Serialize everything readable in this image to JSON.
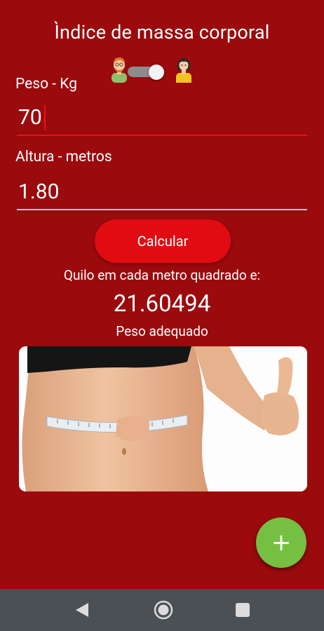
{
  "app": {
    "title": "Ìndice de massa corporal"
  },
  "gender_toggle": {
    "left_icon": "male-avatar-icon",
    "right_icon": "female-avatar-icon",
    "state": "on",
    "track_color": "#8c8c8c",
    "thumb_color": "#f2f2f2"
  },
  "form": {
    "peso_label": "Peso - Kg",
    "peso_value": "70",
    "altura_label": "Altura - metros",
    "altura_value": "1.80"
  },
  "actions": {
    "calcular_label": "Calcular",
    "fab_icon": "plus-icon",
    "fab_symbol": "+"
  },
  "result": {
    "caption": "Quilo em cada metro quadrado e:",
    "value": "21.60494",
    "status": "Peso adequado"
  },
  "image": {
    "subject": "waist-measuring-tape-photo"
  },
  "system_nav": {
    "back_icon": "back-triangle-icon",
    "home_icon": "home-circle-icon",
    "recents_icon": "recents-square-icon"
  },
  "colors": {
    "background": "#9b0a0d",
    "accent": "#e10c12",
    "active_underline": "#e8101a",
    "fab": "#75c043",
    "navbar": "#4a5054"
  }
}
